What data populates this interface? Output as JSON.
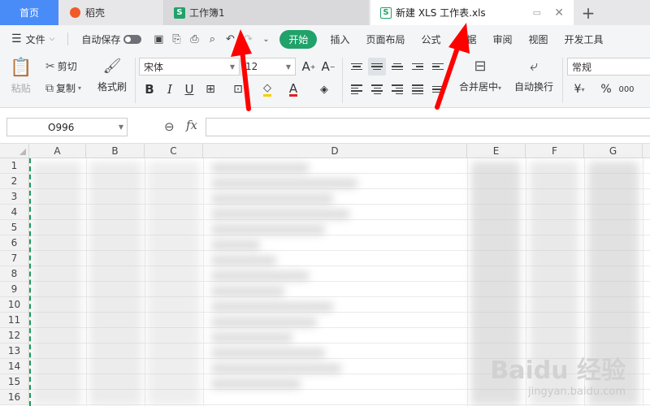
{
  "tabs": {
    "home": "首页",
    "daoke": "稻壳",
    "workbook1": "工作簿1",
    "active": "新建 XLS 工作表.xls",
    "add": "+"
  },
  "menu": {
    "file": "文件",
    "autosave": "自动保存",
    "start": "开始",
    "insert": "插入",
    "page_layout": "页面布局",
    "formula": "公式",
    "data": "数据",
    "review": "审阅",
    "view": "视图",
    "dev_tools": "开发工具"
  },
  "ribbon": {
    "paste": "粘贴",
    "cut": "剪切",
    "copy": "复制",
    "format_painter": "格式刷",
    "font": "宋体",
    "font_size": "12",
    "bold": "B",
    "italic": "I",
    "underline": "U",
    "merge_center": "合并居中",
    "wrap_text": "自动换行",
    "number_format": "常规",
    "currency": "¥",
    "percent": "%",
    "thousands": "000"
  },
  "formula_bar": {
    "name_box": "O996",
    "fx": "fx"
  },
  "columns": [
    "A",
    "B",
    "C",
    "D",
    "E",
    "F",
    "G"
  ],
  "rows": [
    "1",
    "2",
    "3",
    "4",
    "5",
    "6",
    "7",
    "8",
    "9",
    "10",
    "11",
    "12",
    "13",
    "14",
    "15",
    "16"
  ],
  "watermark": {
    "brand": "Baidu 经验",
    "url": "jingyan.baidu.com"
  },
  "colors": {
    "home_tab": "#4a8cf7",
    "accent_green": "#20a26a",
    "arrow_red": "#ff0000"
  }
}
